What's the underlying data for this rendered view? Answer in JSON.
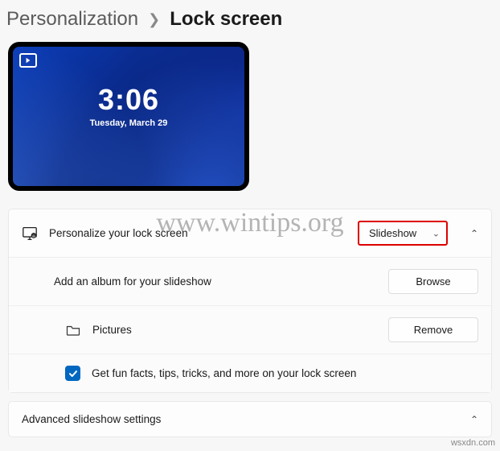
{
  "breadcrumb": {
    "parent": "Personalization",
    "current": "Lock screen"
  },
  "preview": {
    "time": "3:06",
    "date": "Tuesday, March 29"
  },
  "settings": {
    "personalize_label": "Personalize your lock screen",
    "mode_selected": "Slideshow",
    "add_album_label": "Add an album for your slideshow",
    "browse_label": "Browse",
    "folder_label": "Pictures",
    "remove_label": "Remove",
    "fun_facts_label": "Get fun facts, tips, tricks, and more on your lock screen",
    "fun_facts_checked": true
  },
  "advanced": {
    "label": "Advanced slideshow settings"
  },
  "watermark": {
    "main": "www.wintips.org",
    "corner": "wsxdn.com"
  }
}
